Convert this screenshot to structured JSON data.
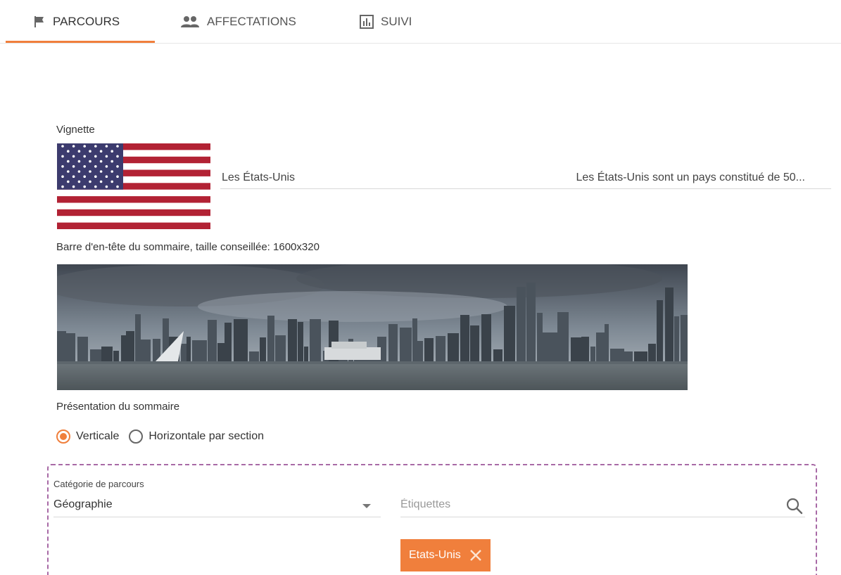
{
  "tabs": [
    {
      "label": "PARCOURS",
      "icon": "flag-icon",
      "active": true
    },
    {
      "label": "AFFECTATIONS",
      "icon": "users-icon",
      "active": false
    },
    {
      "label": "SUIVI",
      "icon": "chart-icon",
      "active": false
    }
  ],
  "accent": "#f07f3c",
  "thumbnail": {
    "label": "Vignette",
    "title": "Les États-Unis",
    "description": "Les États-Unis sont un pays constitué de 50..."
  },
  "banner": {
    "label": "Barre d'en-tête du sommaire, taille conseillée: 1600x320"
  },
  "layout_option": {
    "label": "Présentation du sommaire",
    "options": [
      {
        "label": "Verticale",
        "selected": true
      },
      {
        "label": "Horizontale par section",
        "selected": false
      }
    ]
  },
  "category": {
    "label": "Catégorie de parcours",
    "value": "Géographie"
  },
  "tags": {
    "placeholder": "Étiquettes",
    "items": [
      "Etats-Unis"
    ]
  }
}
